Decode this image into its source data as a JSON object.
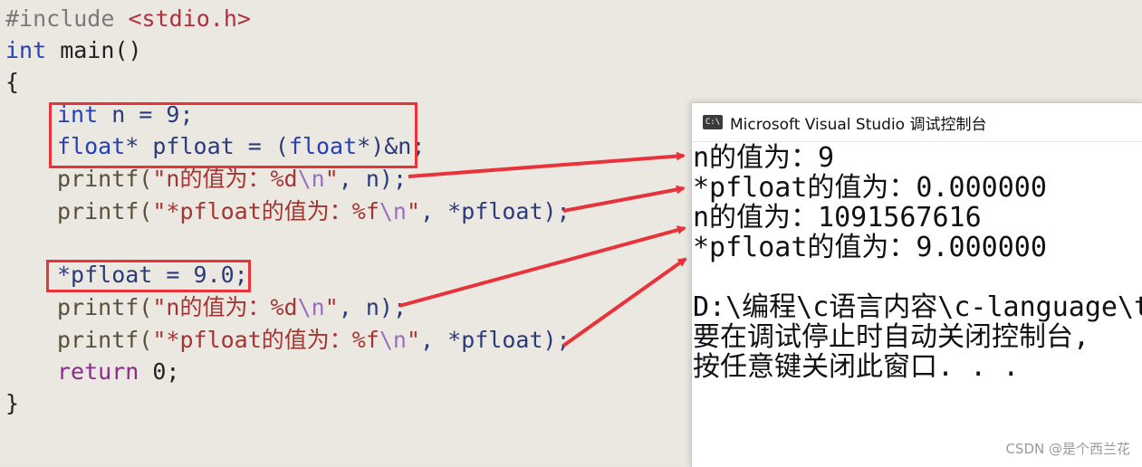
{
  "code": {
    "line1_directive": "#include",
    "line1_path": "<stdio.h>",
    "line2_type": "int",
    "line2_rest": " main()",
    "line3": "{",
    "line4_type": "int",
    "line4_rest": " n = 9;",
    "line5_type": "float",
    "line5_mid": "* pfloat = (",
    "line5_type2": "float",
    "line5_end": "*)&n;",
    "line6_fn": "printf(",
    "line6_str": "\"n的值为：%d",
    "line6_esc": "\\n",
    "line6_close": "\"",
    "line6_end": ", n);",
    "line7_fn": "printf(",
    "line7_str": "\"*pfloat的值为：%f",
    "line7_esc": "\\n",
    "line7_close": "\"",
    "line7_end": ", *pfloat);",
    "line9": "*pfloat = 9.0;",
    "line10_fn": "printf(",
    "line10_str": "\"n的值为：%d",
    "line10_esc": "\\n",
    "line10_close": "\"",
    "line10_end": ", n);",
    "line11_fn": "printf(",
    "line11_str": "\"*pfloat的值为：%f",
    "line11_esc": "\\n",
    "line11_close": "\"",
    "line11_end": ", *pfloat);",
    "line12_kw": "return",
    "line12_rest": " 0;",
    "line13": "}"
  },
  "console": {
    "title": "Microsoft Visual Studio 调试控制台",
    "icon_text": "C:\\",
    "lines": [
      "n的值为：9",
      "*pfloat的值为：0.000000",
      "n的值为：1091567616",
      "*pfloat的值为：9.000000",
      "",
      "D:\\编程\\c语言内容\\c-language\\t",
      "要在调试停止时自动关闭控制台,",
      "按任意键关闭此窗口. . ."
    ]
  },
  "watermark": "CSDN @是个西兰花",
  "colors": {
    "highlight": "#e8333a",
    "arrow": "#e8333a"
  }
}
